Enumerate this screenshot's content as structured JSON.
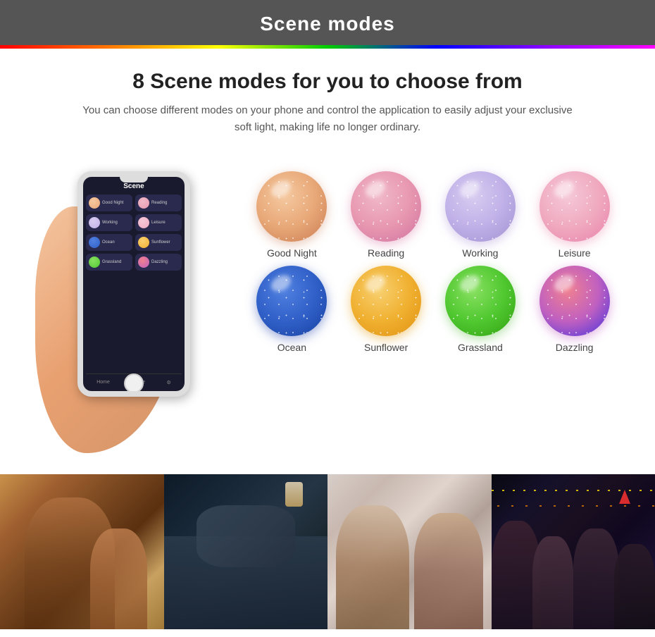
{
  "header": {
    "title": "Scene modes",
    "bg_color": "#555555"
  },
  "main": {
    "title": "8 Scene modes for you to choose from",
    "subtitle": "You can choose different modes on your phone and control the application to easily adjust your exclusive soft light, making life no longer ordinary."
  },
  "phone": {
    "screen_title": "Scene",
    "items": [
      {
        "label": "Good Night",
        "color": "#e8a878"
      },
      {
        "label": "Reading",
        "color": "#e898b0"
      },
      {
        "label": "Working",
        "color": "#c0b0e8"
      },
      {
        "label": "Leisure",
        "color": "#f0aac0"
      },
      {
        "label": "Ocean",
        "color": "#3060c8"
      },
      {
        "label": "Sunflower",
        "color": "#f0b030"
      },
      {
        "label": "Grassland",
        "color": "#50c830"
      },
      {
        "label": "Dazzling",
        "color": "#c060c0"
      }
    ]
  },
  "scenes": [
    {
      "id": "good-night",
      "label": "Good Night",
      "orb_class": "orb-good-night"
    },
    {
      "id": "reading",
      "label": "Reading",
      "orb_class": "orb-reading"
    },
    {
      "id": "working",
      "label": "Working",
      "orb_class": "orb-working"
    },
    {
      "id": "leisure",
      "label": "Leisure",
      "orb_class": "orb-leisure"
    },
    {
      "id": "ocean",
      "label": "Ocean",
      "orb_class": "orb-ocean"
    },
    {
      "id": "sunflower",
      "label": "Sunflower",
      "orb_class": "orb-sunflower"
    },
    {
      "id": "grassland",
      "label": "Grassland",
      "orb_class": "orb-grassland"
    },
    {
      "id": "dazzling",
      "label": "Dazzling",
      "orb_class": "orb-dazzling"
    }
  ]
}
